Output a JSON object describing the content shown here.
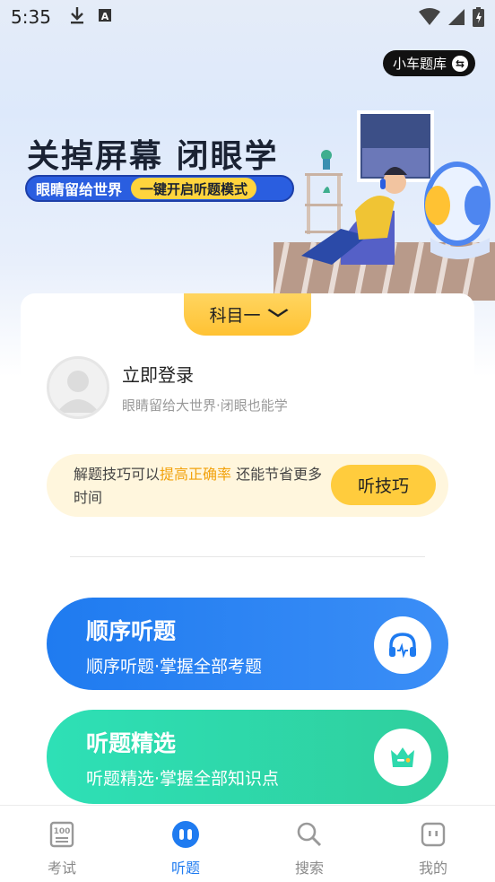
{
  "status_bar": {
    "time": "5:35"
  },
  "library_button": {
    "label": "小车题库"
  },
  "banner": {
    "title": "关掉屏幕 闭眼学",
    "pill_text": "眼睛留给世界",
    "pill_highlight": "一键开启听题模式"
  },
  "subject_selector": {
    "label": "科目一"
  },
  "login": {
    "title": "立即登录",
    "subtitle": "眼睛留给大世界·闭眼也能学"
  },
  "tip": {
    "text_before": "解题技巧可以",
    "text_highlight": "提高正确率",
    "text_after": " 还能节省更多时间",
    "button_label": "听技巧"
  },
  "modes": [
    {
      "title": "顺序听题",
      "subtitle": "顺序听题·掌握全部考题",
      "icon": "headphones-icon",
      "color": "#1f7bf0"
    },
    {
      "title": "听题精选",
      "subtitle": "听题精选·掌握全部知识点",
      "icon": "crown-icon",
      "color": "#2ed9ad"
    }
  ],
  "bottom_nav": [
    {
      "label": "考试",
      "icon": "exam-icon",
      "active": false
    },
    {
      "label": "听题",
      "icon": "earbuds-icon",
      "active": true
    },
    {
      "label": "搜索",
      "icon": "search-icon",
      "active": false
    },
    {
      "label": "我的",
      "icon": "profile-icon",
      "active": false
    }
  ],
  "colors": {
    "accent_blue": "#1f7bf0",
    "accent_yellow": "#ffcc3d",
    "highlight_orange": "#f2a20d"
  }
}
